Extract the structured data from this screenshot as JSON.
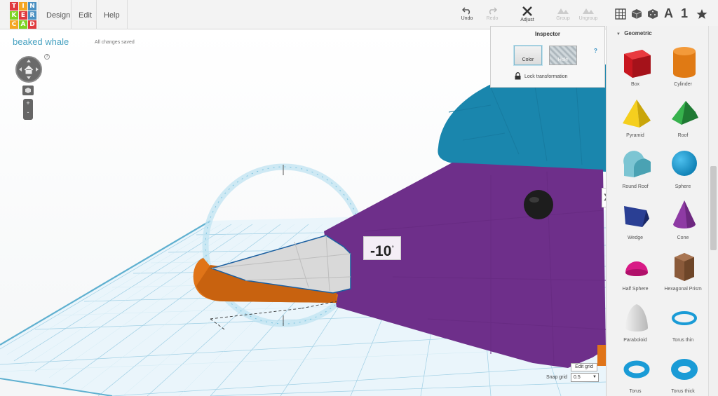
{
  "logo": {
    "letters": [
      "T",
      "I",
      "N",
      "K",
      "E",
      "R",
      "C",
      "A",
      "D"
    ],
    "colors": [
      "#e03a3e",
      "#f5a623",
      "#4a90c2",
      "#7ed321",
      "#e03a3e",
      "#4a90c2",
      "#f5a623",
      "#7ed321",
      "#e03a3e"
    ]
  },
  "menu": {
    "items": [
      {
        "label": "Design"
      },
      {
        "label": "Edit"
      },
      {
        "label": "Help"
      }
    ]
  },
  "toolbar": {
    "undo": "Undo",
    "redo": "Redo",
    "adjust": "Adjust",
    "group": "Group",
    "ungroup": "Ungroup"
  },
  "view_controls": {
    "letter_icon": "A",
    "number_icon": "1"
  },
  "project": {
    "title": "beaked whale",
    "save_status": "All changes saved"
  },
  "navigation": {
    "help": "?",
    "zoom_in": "+",
    "zoom_out": "-"
  },
  "rotation": {
    "value": "-10",
    "unit": "°"
  },
  "grid": {
    "edit_label": "Edit grid",
    "snap_label": "Snap grid",
    "snap_value": "0.5"
  },
  "inspector": {
    "title": "Inspector",
    "color_label": "Color",
    "hole_label": "Hole",
    "help": "?",
    "lock_label": "Lock transformation"
  },
  "sidebar": {
    "collapse_icon": "❯",
    "section_title": "Geometric",
    "shapes": [
      {
        "label": "Box",
        "color": "#d8202a"
      },
      {
        "label": "Cylinder",
        "color": "#e8801a"
      },
      {
        "label": "Pyramid",
        "color": "#f2c40c"
      },
      {
        "label": "Roof",
        "color": "#2ea043"
      },
      {
        "label": "Round Roof",
        "color": "#5fb8c8"
      },
      {
        "label": "Sphere",
        "color": "#1a9bd6"
      },
      {
        "label": "Wedge",
        "color": "#253c8c"
      },
      {
        "label": "Cone",
        "color": "#8b3aa0"
      },
      {
        "label": "Half Sphere",
        "color": "#d81b86"
      },
      {
        "label": "Hexagonal Prism",
        "color": "#8a5a3a"
      },
      {
        "label": "Paraboloid",
        "color": "#d8d8d8"
      },
      {
        "label": "Torus thin",
        "color": "#1a9bd6"
      },
      {
        "label": "Torus",
        "color": "#1a9bd6"
      },
      {
        "label": "Torus thick",
        "color": "#1a9bd6"
      }
    ]
  }
}
